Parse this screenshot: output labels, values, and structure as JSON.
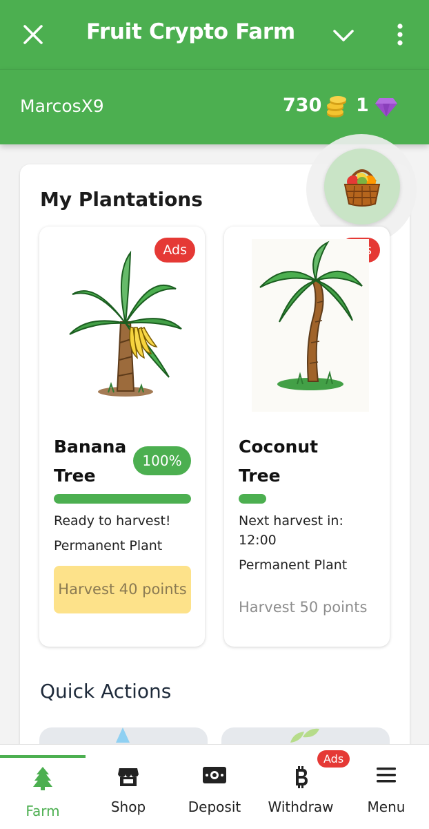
{
  "appbar": {
    "title": "Fruit Crypto Farm",
    "close_icon": "close-icon",
    "chevron_icon": "chevron-down-icon",
    "more_icon": "more-vert-icon"
  },
  "user": {
    "name": "MarcosX9",
    "coins": "730",
    "gems": "1"
  },
  "plantations": {
    "title": "My Plantations",
    "cards": [
      {
        "name_line1": "Banana",
        "name_line2": "Tree",
        "ads": "Ads",
        "percent": "100%",
        "progress": 1.0,
        "status": "Ready to harvest!",
        "type": "Permanent Plant",
        "harvest": "Harvest 40 points"
      },
      {
        "name_line1": "Coconut",
        "name_line2": "Tree",
        "ads": "Ads",
        "progress": 0.2,
        "status_line1": "Next harvest in:",
        "status_line2": "12:00",
        "type": "Permanent Plant",
        "harvest": "Harvest 50 points"
      }
    ]
  },
  "quick_actions": {
    "title": "Quick Actions"
  },
  "bottom_nav": {
    "items": [
      {
        "label": "Farm",
        "icon": "tree-icon",
        "active": true
      },
      {
        "label": "Shop",
        "icon": "store-icon"
      },
      {
        "label": "Deposit",
        "icon": "cash-icon"
      },
      {
        "label": "Withdraw",
        "icon": "bitcoin-icon",
        "badge": "Ads"
      },
      {
        "label": "Menu",
        "icon": "menu-icon"
      }
    ]
  },
  "colors": {
    "primary": "#4caf50",
    "ads_badge": "#e53935",
    "harvest_button": "#fde28a"
  }
}
